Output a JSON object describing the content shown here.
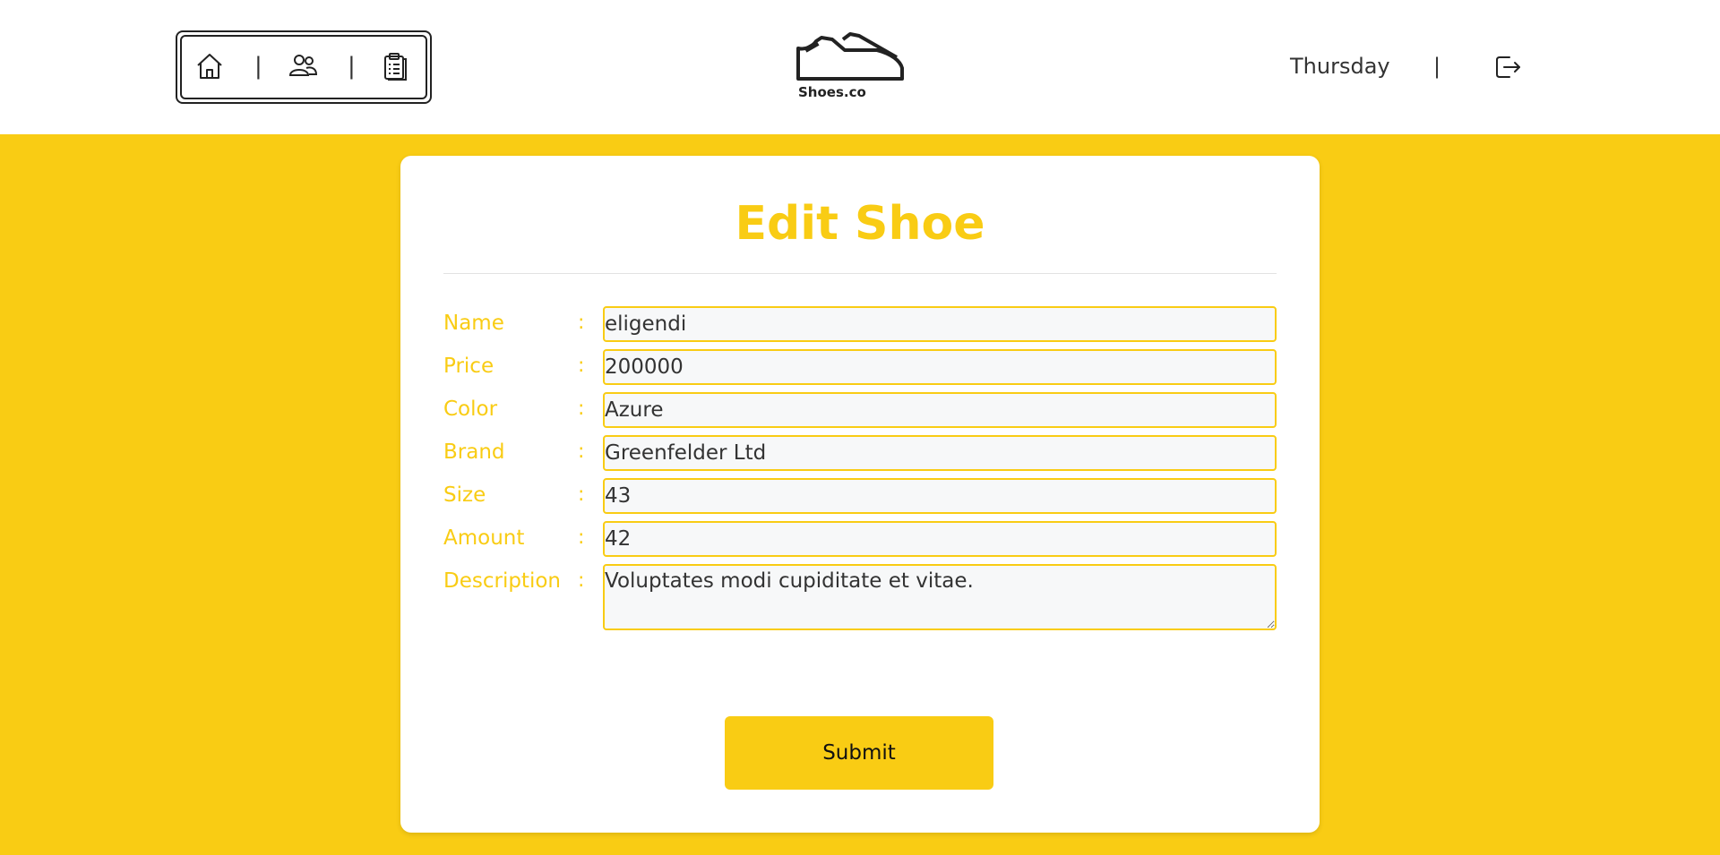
{
  "header": {
    "nav_separator": "|",
    "logo_text": "Shoes.co",
    "day": "Thursday",
    "separator": "|",
    "nav_icons": [
      "home-icon",
      "users-icon",
      "clipboard-icon"
    ],
    "logout_icon": "logout-icon"
  },
  "form": {
    "title": "Edit Shoe",
    "colon": ":",
    "fields": [
      {
        "label": "Name",
        "value": "eligendi"
      },
      {
        "label": "Price",
        "value": "200000"
      },
      {
        "label": "Color",
        "value": "Azure"
      },
      {
        "label": "Brand",
        "value": "Greenfelder Ltd"
      },
      {
        "label": "Size",
        "value": "43"
      },
      {
        "label": "Amount",
        "value": "42"
      },
      {
        "label": "Description",
        "value": "Voluptates modi cupiditate et vitae."
      }
    ],
    "submit_label": "Submit"
  },
  "colors": {
    "accent": "#f9cc14",
    "card": "#ffffff",
    "input_bg": "#f7f8f9",
    "text": "#333333"
  }
}
